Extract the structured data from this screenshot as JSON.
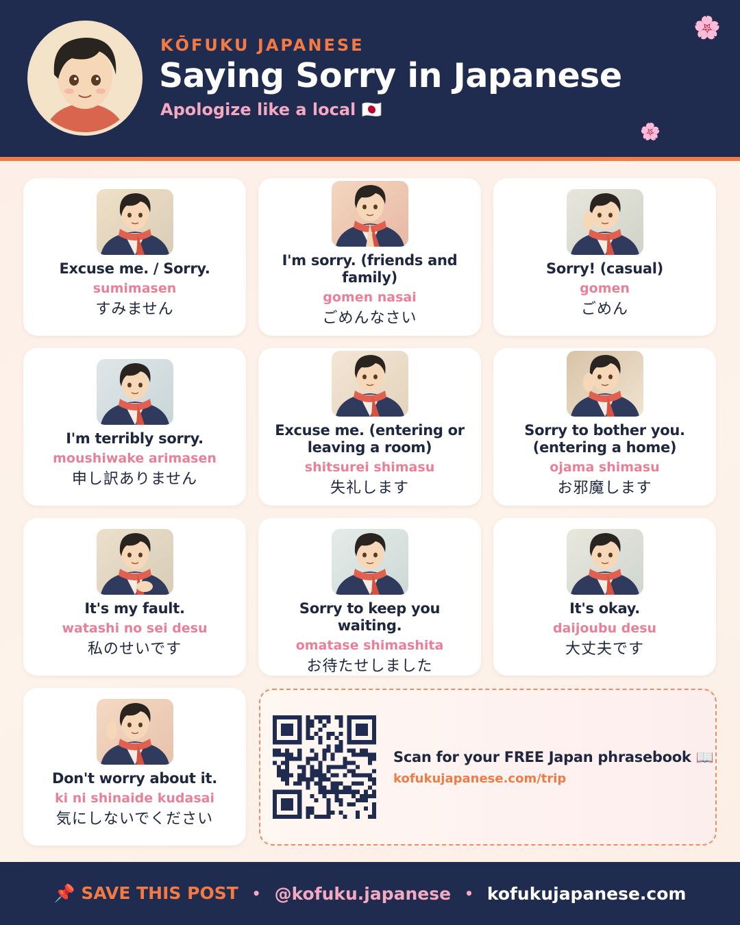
{
  "header": {
    "brand": "KŌFUKU JAPANESE",
    "title": "Saying Sorry in Japanese",
    "subtitle": "Apologize like a local 🇯🇵",
    "blossom_icon": "🌸"
  },
  "phrases": [
    {
      "english": "Excuse me. / Sorry.",
      "romaji": "sumimasen",
      "japanese": "すみません",
      "gesture": "neutral"
    },
    {
      "english": "I'm sorry. (friends and family)",
      "romaji": "gomen nasai",
      "japanese": "ごめんなさい",
      "gesture": "hands-pressed"
    },
    {
      "english": "Sorry! (casual)",
      "romaji": "gomen",
      "japanese": "ごめん",
      "gesture": "hand-raised"
    },
    {
      "english": "I'm terribly sorry.",
      "romaji": "moushiwake arimasen",
      "japanese": "申し訳ありません",
      "gesture": "bow"
    },
    {
      "english": "Excuse me. (entering or leaving a room)",
      "romaji": "shitsurei shimasu",
      "japanese": "失礼します",
      "gesture": "head-tilt"
    },
    {
      "english": "Sorry to bother you. (entering a home)",
      "romaji": "ojama shimasu",
      "japanese": "お邪魔します",
      "gesture": "wave"
    },
    {
      "english": "It's my fault.",
      "romaji": "watashi no sei desu",
      "japanese": "私のせいです",
      "gesture": "hand-on-chest"
    },
    {
      "english": "Sorry to keep you waiting.",
      "romaji": "omatase shimashita",
      "japanese": "お待たせしました",
      "gesture": "smile"
    },
    {
      "english": "It's okay.",
      "romaji": "daijoubu desu",
      "japanese": "大丈夫です",
      "gesture": "smile"
    },
    {
      "english": "Don't worry about it.",
      "romaji": "ki ni shinaide kudasai",
      "japanese": "気にしないでください",
      "gesture": "wave"
    }
  ],
  "promo": {
    "title": "Scan for your FREE Japan phrasebook 📖",
    "link": "kofukujapanese.com/trip",
    "qr_icon": "qr-code"
  },
  "footer": {
    "save": "📌 SAVE THIS POST",
    "separator": "•",
    "handle": "@kofuku.japanese",
    "site": "kofukujapanese.com"
  },
  "colors": {
    "navy": "#1f2b4f",
    "accent_orange": "#f27a45",
    "accent_pink": "#ea7f98",
    "subtitle_pink": "#f3a9c2",
    "scarf_red": "#e0614f"
  }
}
